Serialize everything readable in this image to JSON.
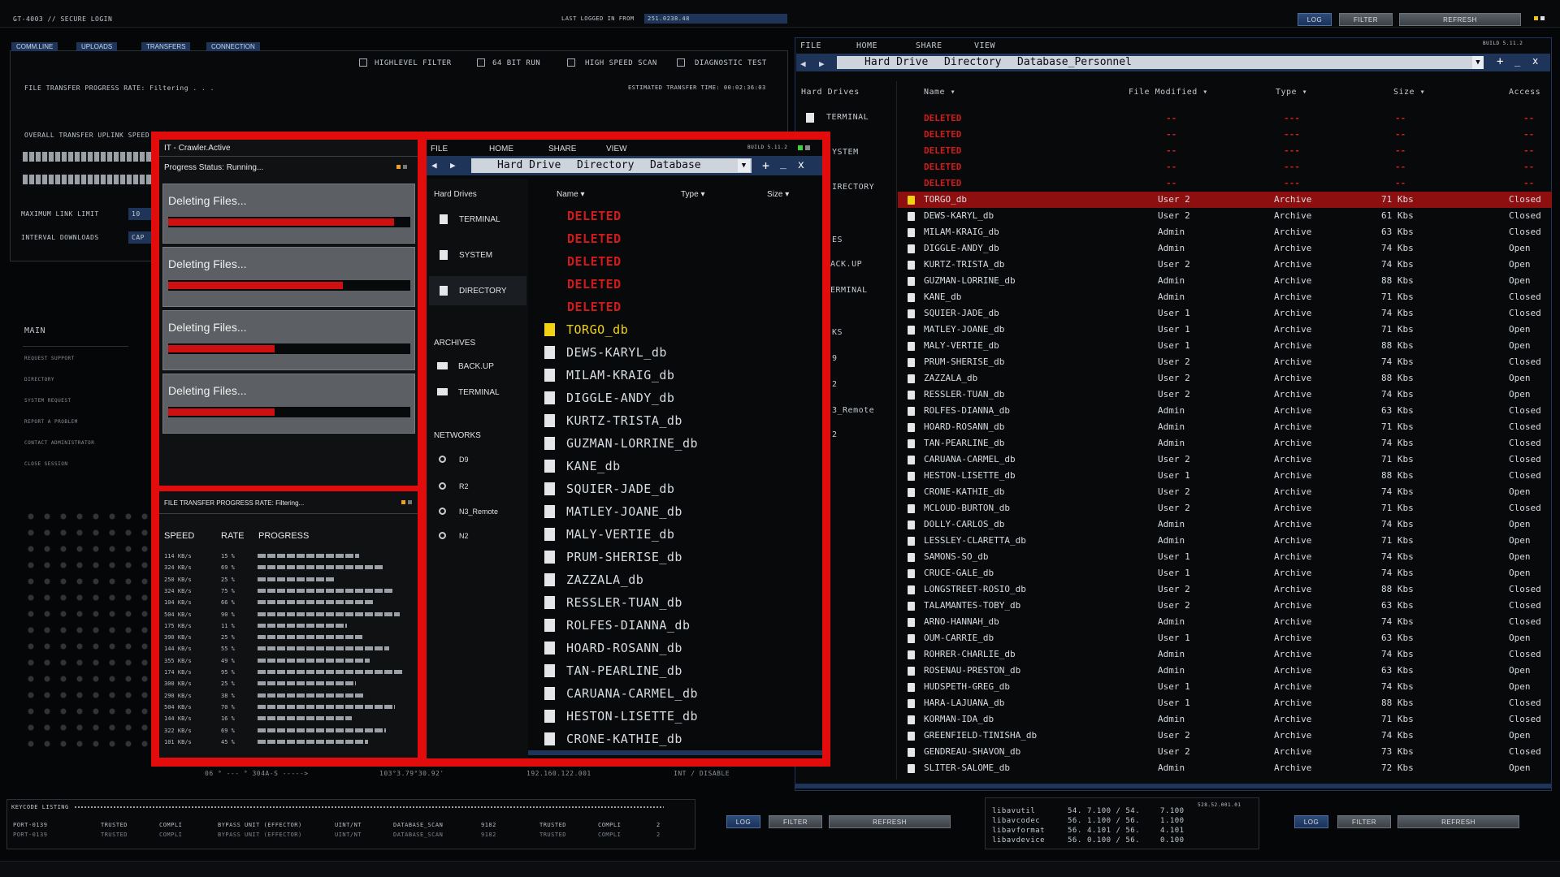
{
  "header": {
    "title": "GT-4003 // SECURE LOGIN",
    "last_logged_label": "LAST LOGGED IN FROM",
    "last_logged_ip": "251.0238.48",
    "log": "LOG",
    "filter": "FILTER",
    "refresh": "REFRESH"
  },
  "left_tabs": [
    "COMM.LINE",
    "UPLOADS",
    "TRANSFERS",
    "CONNECTION"
  ],
  "checkboxes": [
    "HIGHLEVEL FILTER",
    "64 BIT RUN",
    "HIGH SPEED SCAN",
    "DIAGNOSTIC TEST"
  ],
  "transfer": {
    "rate_label": "FILE TRANSFER PROGRESS RATE: Filtering . . .",
    "estimated": "ESTIMATED TRANSFER TIME: 00:02:36:03",
    "uplink": "OVERALL TRANSFER UPLINK SPEED:",
    "max_link": "MAXIMUM LINK LIMIT",
    "max_link_val": "10",
    "interval": "INTERVAL DOWNLOADS",
    "interval_val": "CAP"
  },
  "left_menu": {
    "heading": "MAIN",
    "items": [
      "REQUEST SUPPORT",
      "DIRECTORY",
      "SYSTEM REQUEST",
      "REPORT A PROBLEM",
      "CONTACT ADMINISTRATOR",
      "CLOSE SESSION"
    ]
  },
  "crawler": {
    "title": "IT - Crawler.Active",
    "status": "Progress Status: Running...",
    "tasks": [
      {
        "label": "Deleting Files...",
        "progress": 0.96
      },
      {
        "label": "Deleting Files...",
        "progress": 0.74
      },
      {
        "label": "Deleting Files...",
        "progress": 0.45
      },
      {
        "label": "Deleting Files...",
        "progress": 0.45
      }
    ]
  },
  "progress_panel": {
    "title": "FILE TRANSFER PROGRESS RATE:  Filtering...",
    "headers": [
      "SPEED",
      "RATE",
      "PROGRESS"
    ],
    "rows": [
      {
        "speed": "114 KB/s",
        "rate": "15 %",
        "progress": 0.68
      },
      {
        "speed": "324 KB/s",
        "rate": "69 %",
        "progress": 0.85
      },
      {
        "speed": "250 KB/s",
        "rate": "25 %",
        "progress": 0.52
      },
      {
        "speed": "324 KB/s",
        "rate": "75 %",
        "progress": 0.9
      },
      {
        "speed": "104 KB/s",
        "rate": "66 %",
        "progress": 0.78
      },
      {
        "speed": "504 KB/s",
        "rate": "90 %",
        "progress": 0.95
      },
      {
        "speed": "175 KB/s",
        "rate": "11 %",
        "progress": 0.6
      },
      {
        "speed": "390 KB/s",
        "rate": "25 %",
        "progress": 0.7
      },
      {
        "speed": "144 KB/s",
        "rate": "55 %",
        "progress": 0.88
      },
      {
        "speed": "355 KB/s",
        "rate": "49 %",
        "progress": 0.75
      },
      {
        "speed": "174 KB/s",
        "rate": "95 %",
        "progress": 0.97
      },
      {
        "speed": "300 KB/s",
        "rate": "25 %",
        "progress": 0.66
      },
      {
        "speed": "290 KB/s",
        "rate": "38 %",
        "progress": 0.72
      },
      {
        "speed": "504 KB/s",
        "rate": "70 %",
        "progress": 0.92
      },
      {
        "speed": "144 KB/s",
        "rate": "16 %",
        "progress": 0.63
      },
      {
        "speed": "322 KB/s",
        "rate": "69 %",
        "progress": 0.86
      },
      {
        "speed": "101 KB/s",
        "rate": "45 %",
        "progress": 0.74
      }
    ]
  },
  "explorer_menu": [
    "FILE",
    "HOME",
    "SHARE",
    "VIEW"
  ],
  "build": "BUILD 5.11.2",
  "center_explorer": {
    "path": [
      "Hard Drive",
      "Directory",
      "Database"
    ],
    "hard_drives_label": "Hard Drives",
    "drives": [
      "TERMINAL",
      "SYSTEM",
      "DIRECTORY"
    ],
    "archives_label": "ARCHIVES",
    "archives": [
      "BACK.UP",
      "TERMINAL"
    ],
    "networks_label": "NETWORKS",
    "networks": [
      "D9",
      "R2",
      "N3_Remote",
      "N2"
    ],
    "col_name": "Name",
    "col_type": "Type",
    "col_size": "Size",
    "files": [
      "DELETED",
      "DELETED",
      "DELETED",
      "DELETED",
      "DELETED",
      "TORGO_db",
      "DEWS-KARYL_db",
      "MILAM-KRAIG_db",
      "DIGGLE-ANDY_db",
      "KURTZ-TRISTA_db",
      "GUZMAN-LORRINE_db",
      "KANE_db",
      "SQUIER-JADE_db",
      "MATLEY-JOANE_db",
      "MALY-VERTIE_db",
      "PRUM-SHERISE_db",
      "ZAZZALA_db",
      "RESSLER-TUAN_db",
      "ROLFES-DIANNA_db",
      "HOARD-ROSANN_db",
      "TAN-PEARLINE_db",
      "CARUANA-CARMEL_db",
      "HESTON-LISETTE_db",
      "CRONE-KATHIE_db"
    ]
  },
  "right_explorer": {
    "path": [
      "Hard Drive",
      "Directory",
      "Database_Personnel"
    ],
    "hard_drives_label": "Hard Drives",
    "side_items": [
      "TERMINAL",
      "YSTEM",
      "IRECTORY",
      "ES",
      "ACK.UP",
      "ERMINAL",
      "KS",
      "9",
      "2",
      "3_Remote",
      "2"
    ],
    "columns": [
      "Name",
      "File Modified",
      "Type",
      "Size",
      "Access"
    ],
    "deleted_rows": [
      "DELETED",
      "DELETED",
      "DELETED",
      "DELETED",
      "DELETED"
    ],
    "dashes": "--",
    "dashes3": "---",
    "rows": [
      {
        "name": "TORGO_db",
        "user": "User 2",
        "type": "Archive",
        "size": "71 Kbs",
        "access": "Closed"
      },
      {
        "name": "DEWS-KARYL_db",
        "user": "User 2",
        "type": "Archive",
        "size": "61 Kbs",
        "access": "Closed"
      },
      {
        "name": "MILAM-KRAIG_db",
        "user": "Admin",
        "type": "Archive",
        "size": "63 Kbs",
        "access": "Closed"
      },
      {
        "name": "DIGGLE-ANDY_db",
        "user": "Admin",
        "type": "Archive",
        "size": "74 Kbs",
        "access": "Open"
      },
      {
        "name": "KURTZ-TRISTA_db",
        "user": "User 2",
        "type": "Archive",
        "size": "74 Kbs",
        "access": "Open"
      },
      {
        "name": "GUZMAN-LORRINE_db",
        "user": "Admin",
        "type": "Archive",
        "size": "88 Kbs",
        "access": "Open"
      },
      {
        "name": "KANE_db",
        "user": "Admin",
        "type": "Archive",
        "size": "71 Kbs",
        "access": "Closed"
      },
      {
        "name": "SQUIER-JADE_db",
        "user": "User 1",
        "type": "Archive",
        "size": "74 Kbs",
        "access": "Closed"
      },
      {
        "name": "MATLEY-JOANE_db",
        "user": "User 1",
        "type": "Archive",
        "size": "71 Kbs",
        "access": "Open"
      },
      {
        "name": "MALY-VERTIE_db",
        "user": "User 1",
        "type": "Archive",
        "size": "88 Kbs",
        "access": "Open"
      },
      {
        "name": "PRUM-SHERISE_db",
        "user": "User 2",
        "type": "Archive",
        "size": "74 Kbs",
        "access": "Closed"
      },
      {
        "name": "ZAZZALA_db",
        "user": "User 2",
        "type": "Archive",
        "size": "88 Kbs",
        "access": "Open"
      },
      {
        "name": "RESSLER-TUAN_db",
        "user": "User 2",
        "type": "Archive",
        "size": "74 Kbs",
        "access": "Open"
      },
      {
        "name": "ROLFES-DIANNA_db",
        "user": "Admin",
        "type": "Archive",
        "size": "63 Kbs",
        "access": "Closed"
      },
      {
        "name": "HOARD-ROSANN_db",
        "user": "Admin",
        "type": "Archive",
        "size": "71 Kbs",
        "access": "Closed"
      },
      {
        "name": "TAN-PEARLINE_db",
        "user": "Admin",
        "type": "Archive",
        "size": "74 Kbs",
        "access": "Closed"
      },
      {
        "name": "CARUANA-CARMEL_db",
        "user": "User 2",
        "type": "Archive",
        "size": "71 Kbs",
        "access": "Closed"
      },
      {
        "name": "HESTON-LISETTE_db",
        "user": "User 1",
        "type": "Archive",
        "size": "88 Kbs",
        "access": "Closed"
      },
      {
        "name": "CRONE-KATHIE_db",
        "user": "User 2",
        "type": "Archive",
        "size": "74 Kbs",
        "access": "Open"
      },
      {
        "name": "MCLOUD-BURTON_db",
        "user": "User 2",
        "type": "Archive",
        "size": "71 Kbs",
        "access": "Closed"
      },
      {
        "name": "DOLLY-CARLOS_db",
        "user": "Admin",
        "type": "Archive",
        "size": "74 Kbs",
        "access": "Open"
      },
      {
        "name": "LESSLEY-CLARETTA_db",
        "user": "Admin",
        "type": "Archive",
        "size": "71 Kbs",
        "access": "Open"
      },
      {
        "name": "SAMONS-SO_db",
        "user": "User 1",
        "type": "Archive",
        "size": "74 Kbs",
        "access": "Open"
      },
      {
        "name": "CRUCE-GALE_db",
        "user": "User 1",
        "type": "Archive",
        "size": "74 Kbs",
        "access": "Open"
      },
      {
        "name": "LONGSTREET-ROSIO_db",
        "user": "User 2",
        "type": "Archive",
        "size": "88 Kbs",
        "access": "Closed"
      },
      {
        "name": "TALAMANTES-TOBY_db",
        "user": "User 2",
        "type": "Archive",
        "size": "63 Kbs",
        "access": "Closed"
      },
      {
        "name": "ARNO-HANNAH_db",
        "user": "Admin",
        "type": "Archive",
        "size": "74 Kbs",
        "access": "Closed"
      },
      {
        "name": "OUM-CARRIE_db",
        "user": "User 1",
        "type": "Archive",
        "size": "63 Kbs",
        "access": "Open"
      },
      {
        "name": "ROHRER-CHARLIE_db",
        "user": "Admin",
        "type": "Archive",
        "size": "74 Kbs",
        "access": "Closed"
      },
      {
        "name": "ROSENAU-PRESTON_db",
        "user": "Admin",
        "type": "Archive",
        "size": "63 Kbs",
        "access": "Open"
      },
      {
        "name": "HUDSPETH-GREG_db",
        "user": "User 1",
        "type": "Archive",
        "size": "74 Kbs",
        "access": "Open"
      },
      {
        "name": "HARA-LAJUANA_db",
        "user": "User 1",
        "type": "Archive",
        "size": "88 Kbs",
        "access": "Closed"
      },
      {
        "name": "KORMAN-IDA_db",
        "user": "Admin",
        "type": "Archive",
        "size": "71 Kbs",
        "access": "Closed"
      },
      {
        "name": "GREENFIELD-TINISHA_db",
        "user": "User 2",
        "type": "Archive",
        "size": "74 Kbs",
        "access": "Open"
      },
      {
        "name": "GENDREAU-SHAVON_db",
        "user": "User 2",
        "type": "Archive",
        "size": "73 Kbs",
        "access": "Closed"
      },
      {
        "name": "SLITER-SALOME_db",
        "user": "Admin",
        "type": "Archive",
        "size": "72 Kbs",
        "access": "Open"
      }
    ]
  },
  "coords_strip": [
    "06 ° --- ° 304A-S ----->",
    "103°3.79°30.92'",
    "192.160.122.001",
    "INT / DISABLE"
  ],
  "keycode": {
    "title": "KEYCODE LISTING",
    "rows": [
      [
        "PORT-0139",
        "TRUSTED",
        "COMPLI",
        "BYPASS UNIT (EFFECTOR)",
        "UINT/NT",
        "DATABASE_SCAN",
        "9182",
        "TRUSTED",
        "COMPLI",
        "2"
      ],
      [
        "PORT-0139",
        "TRUSTED",
        "COMPLI",
        "BYPASS UNIT (EFFECTOR)",
        "UINT/NT",
        "DATABASE_SCAN",
        "9182",
        "TRUSTED",
        "COMPLI",
        "2"
      ]
    ]
  },
  "libs": {
    "id": "528.52.001.01",
    "rows": [
      [
        "libavutil",
        "54.",
        "7.100 / 54.",
        "7.100"
      ],
      [
        "libavcodec",
        "56.",
        "1.100 / 56.",
        "1.100"
      ],
      [
        "libavformat",
        "56.",
        "4.101 / 56.",
        "4.101"
      ],
      [
        "libavdevice",
        "56.",
        "0.100 / 56.",
        "0.100"
      ]
    ]
  },
  "colors": {
    "accent_red": "#e20c0c",
    "select_red": "#8e0f0f",
    "file_yellow": "#f1d214",
    "deleted_red": "#d11a1a",
    "tab_blue": "#1e3559"
  }
}
